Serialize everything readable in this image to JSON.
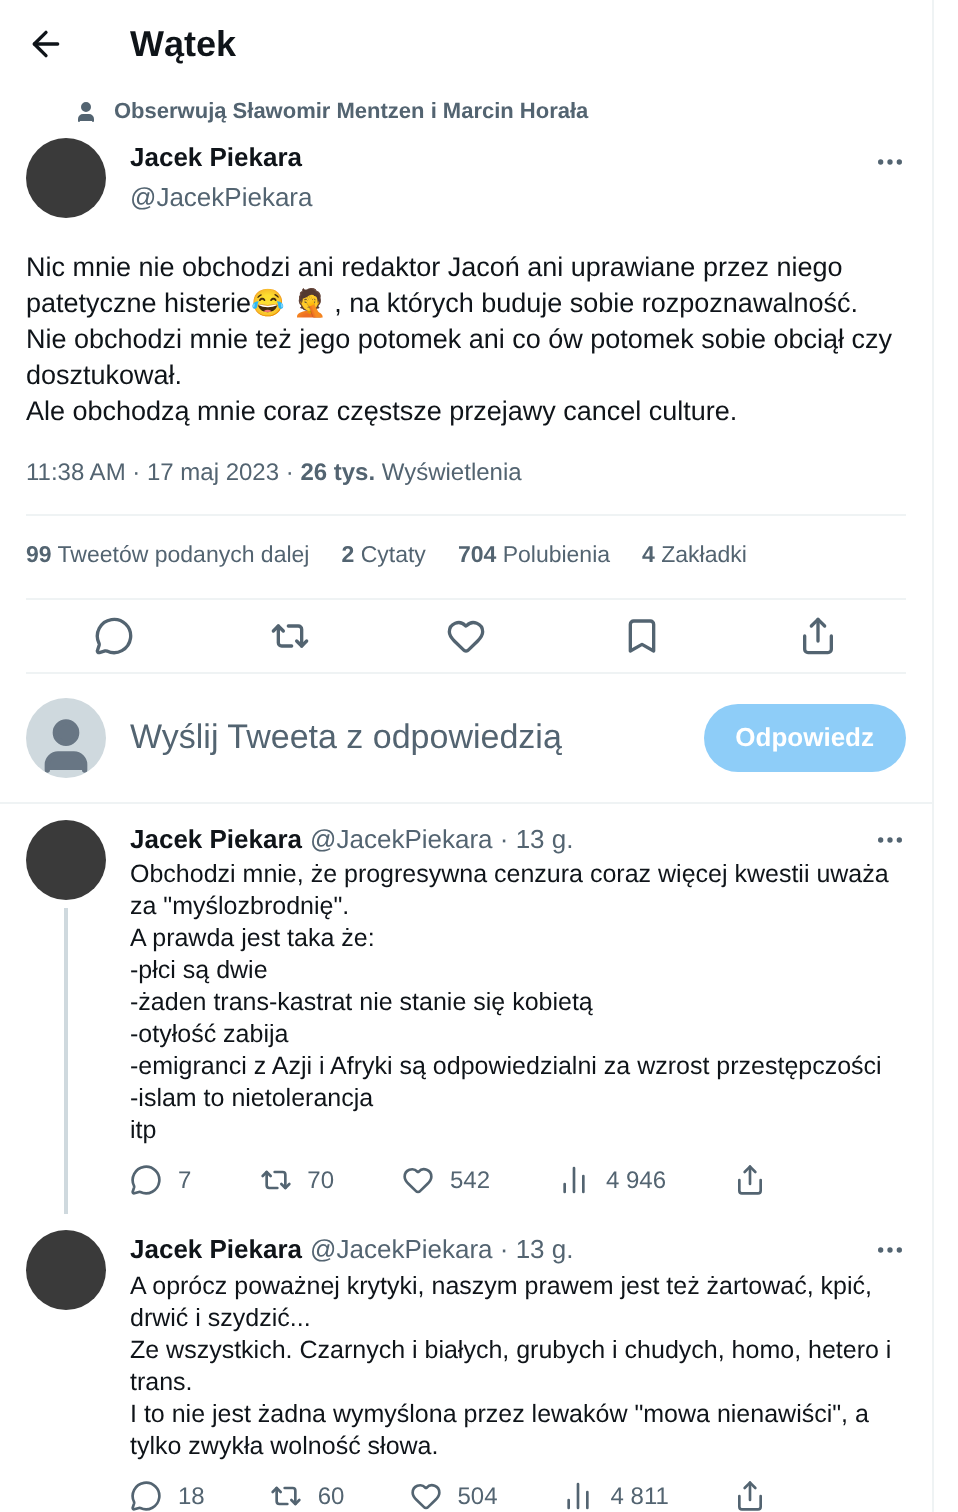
{
  "header": {
    "title": "Wątek"
  },
  "social_context": "Obserwują Sławomir Mentzen i Marcin Horała",
  "tweet": {
    "name": "Jacek Piekara",
    "handle": "@JacekPiekara",
    "text": "Nic mnie nie obchodzi ani redaktor Jacoń ani uprawiane przez niego patetyczne histerie😂 🤦 , na których buduje sobie rozpoznawalność.\nNie obchodzi mnie też jego potomek ani co ów potomek sobie obciął czy dosztukował.\nAle obchodzą mnie coraz częstsze przejawy cancel culture.",
    "meta": "11:38 AM · 17 maj 2023 · **26 tys.** Wyświetlenia",
    "stats": [
      "**99** Tweetów podanych dalej",
      "**2** Cytaty",
      "**704** Polubienia",
      "**4** Zakładki"
    ]
  },
  "reply_box": {
    "placeholder": "Wyślij Tweeta z odpowiedzią",
    "button": "Odpowiedz"
  },
  "replies": [
    {
      "name": "Jacek Piekara",
      "handle": "@JacekPiekara · 13 g.",
      "thread_line": true,
      "text": "Obchodzi mnie, że progresywna cenzura coraz więcej kwestii uważa za \"myślozbrodnię\".\nA prawda jest taka że:\n-płci są dwie\n-żaden trans-kastrat nie stanie się kobietą\n-otyłość zabija\n-emigranci z Azji i Afryki są odpowiedzialni za wzrost przestępczości\n-islam to nietolerancja\nitp",
      "replies": "7",
      "retweets": "70",
      "likes": "542",
      "views": "4 946"
    },
    {
      "name": "Jacek Piekara",
      "handle": "@JacekPiekara · 13 g.",
      "thread_line": false,
      "text": "A oprócz poważnej krytyki, naszym prawem jest też żartować, kpić, drwić i szydzić...\nZe wszystkich. Czarnych i białych, grubych i chudych, homo, hetero i trans.\nI to nie jest żadna wymyślona przez lewaków \"mowa nienawiści\", a tylko zwykła wolność słowa.",
      "replies": "18",
      "retweets": "60",
      "likes": "504",
      "views": "4 811"
    }
  ]
}
